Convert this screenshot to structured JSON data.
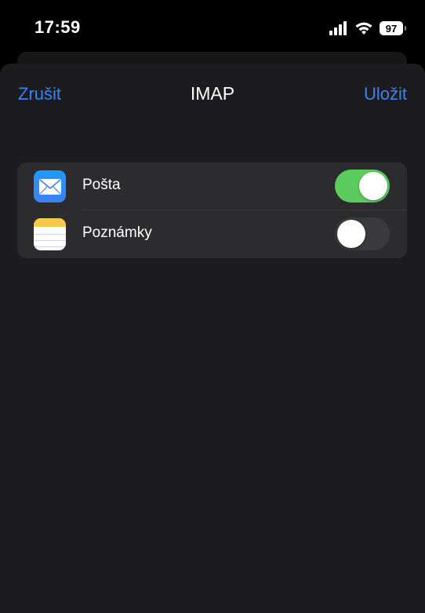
{
  "status_bar": {
    "time": "17:59",
    "battery": "97",
    "icons": [
      "signal-icon",
      "wifi-icon",
      "battery-icon"
    ]
  },
  "nav": {
    "cancel_label": "Zrušit",
    "title": "IMAP",
    "save_label": "Uložit"
  },
  "colors": {
    "accent": "#3b82f6",
    "toggle_on": "#5ccc61",
    "toggle_off": "#3a3a3c",
    "sheet_background": "#1c1c1e",
    "group_background": "#2c2c2e"
  },
  "services": [
    {
      "icon": "mail-app-icon",
      "label": "Pošta",
      "enabled": true
    },
    {
      "icon": "notes-app-icon",
      "label": "Poznámky",
      "enabled": false
    }
  ]
}
